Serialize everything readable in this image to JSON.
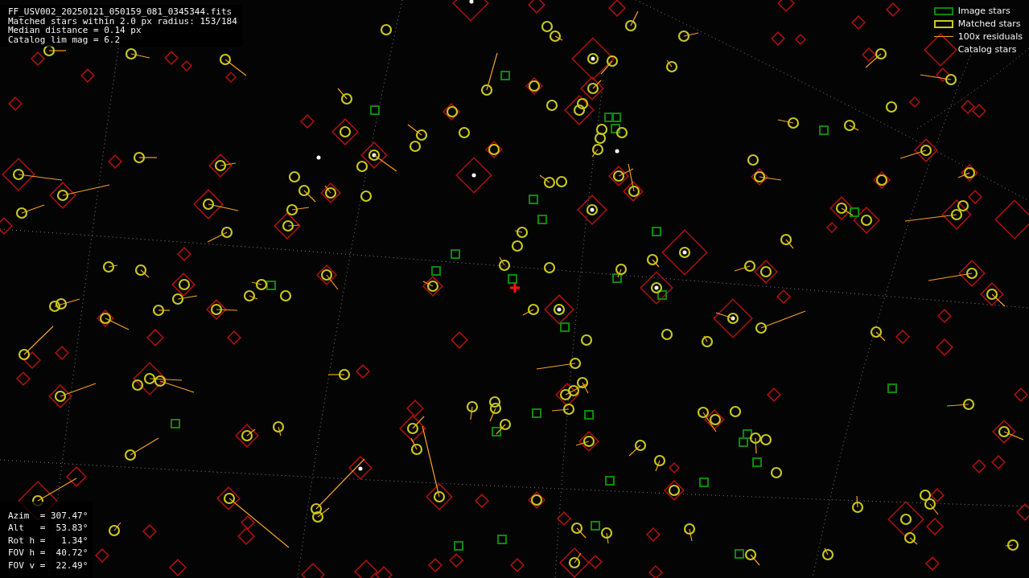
{
  "header_info": {
    "lines": [
      "FF_USV002_20250121_050159_081_0345344.fits",
      "Matched stars within 2.0 px radius: 153/184",
      "Median distance = 0.14 px",
      "Catalog lim mag = 6.2"
    ]
  },
  "legend": {
    "items": [
      {
        "kind": "box",
        "label": "Image stars",
        "color": "#0a8a0a"
      },
      {
        "kind": "box",
        "label": "Matched stars",
        "color": "#c8c81e"
      },
      {
        "kind": "line",
        "label": "100x residuals",
        "color": "#f5a020"
      },
      {
        "kind": "none",
        "label": "Catalog stars"
      }
    ]
  },
  "pointing_info": {
    "lines": [
      "Azim  = 307.47°",
      "Alt   =  53.83°",
      "Rot h =   1.34°",
      "FOV h =  40.72°",
      "FOV v =  22.49°"
    ]
  }
}
